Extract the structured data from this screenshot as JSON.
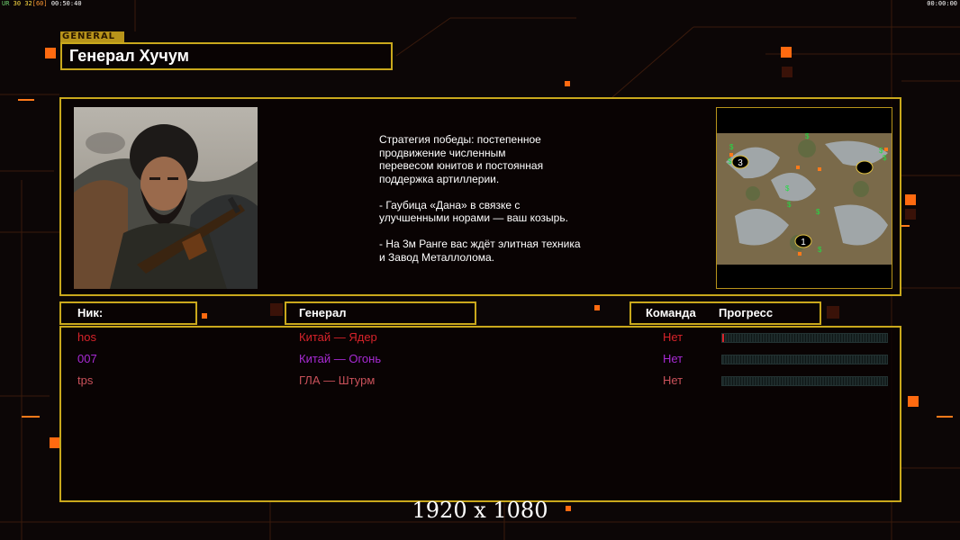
{
  "hud": {
    "left_label": "UR",
    "fps_a": "30",
    "fps_b": "32",
    "fps_bracket": "[60]",
    "time_left": "00:50:40",
    "time_right": "00:00:00"
  },
  "general_tag": "GENERAL",
  "general_name": "Генерал Хучум",
  "portrait_icon": "general-portrait-image",
  "strategy_text": "Стратегия победы: постепенное\nпродвижение численным\nперевесом юнитов и постоянная\nподдержка артиллерии.\n\n- Гаубица «Дана» в связке с\nулучшенными норами — ваш козырь.\n\n- На 3м Ранге вас ждёт элитная техника\nи Завод Металлолома.",
  "minimap": {
    "icon": "minimap-image",
    "markers": [
      "3",
      "1"
    ]
  },
  "table_headers": {
    "nick": "Ник:",
    "general": "Генерал",
    "team": "Команда",
    "progress": "Прогресс"
  },
  "players": [
    {
      "nick": "hos",
      "general": "Китай — Ядер",
      "team": "Нет",
      "color": "#d7232a",
      "progress": 0.0
    },
    {
      "nick": "007",
      "general": "Китай — Огонь",
      "team": "Нет",
      "color": "#a82ad4",
      "progress": 0.0
    },
    {
      "nick": "tps",
      "general": "ГЛА — Штурм",
      "team": "Нет",
      "color": "#c9515a",
      "progress": 0.0
    }
  ],
  "resolution_text": "1920 x 1080",
  "colors": {
    "frame": "#c9a81c",
    "accent": "#ff7a1a"
  }
}
